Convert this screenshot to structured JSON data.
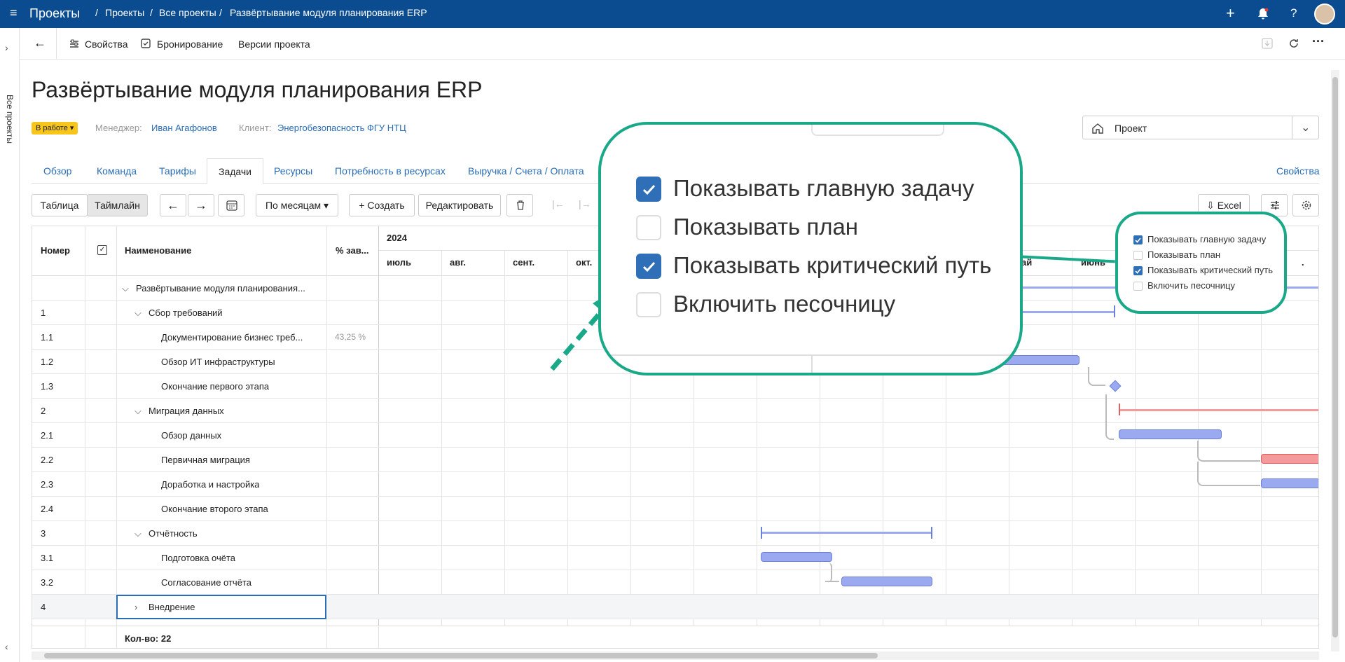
{
  "topbar": {
    "app_title": "Проекты",
    "breadcrumb": [
      "Проекты",
      "Все проекты",
      "Развёртывание модуля планирования ERP"
    ],
    "sep": "/"
  },
  "left_strip": {
    "label": "Все проекты"
  },
  "toolbar": {
    "properties": "Свойства",
    "booking": "Бронирование",
    "versions": "Версии проекта"
  },
  "project": {
    "title": "Развёртывание модуля планирования ERP",
    "status": "В работе",
    "manager_label": "Менеджер:",
    "manager": "Иван Агафонов",
    "client_label": "Клиент:",
    "client": "Энергобезопасность ФГУ НТЦ",
    "view_select": "Проект"
  },
  "tabs": [
    "Обзор",
    "Команда",
    "Тарифы",
    "Задачи",
    "Ресурсы",
    "Потребность в ресурсах",
    "Выручка / Счета / Оплата"
  ],
  "tabs_right": "Свойства",
  "task_toolbar": {
    "table": "Таблица",
    "timeline": "Таймлайн",
    "period": "По месяцам",
    "create": "+ Создать",
    "edit": "Редактировать",
    "excel": "Excel"
  },
  "grid": {
    "headers": {
      "number": "Номер",
      "name": "Наименование",
      "percent": "% зав..."
    },
    "year": "2024",
    "months": [
      "июль",
      "авг.",
      "сент.",
      "окт.",
      "ай",
      "июнь",
      "."
    ],
    "rows": [
      {
        "num": "",
        "name": "Развёртывание модуля планирования...",
        "pct": ""
      },
      {
        "num": "1",
        "name": "Сбор требований",
        "pct": ""
      },
      {
        "num": "1.1",
        "name": "Документирование бизнес треб...",
        "pct": "43,25 %"
      },
      {
        "num": "1.2",
        "name": "Обзор ИТ инфраструктуры",
        "pct": ""
      },
      {
        "num": "1.3",
        "name": "Окончание первого этапа",
        "pct": ""
      },
      {
        "num": "2",
        "name": "Миграция данных",
        "pct": ""
      },
      {
        "num": "2.1",
        "name": "Обзор данных",
        "pct": ""
      },
      {
        "num": "2.2",
        "name": "Первичная миграция",
        "pct": ""
      },
      {
        "num": "2.3",
        "name": "Доработка и настройка",
        "pct": ""
      },
      {
        "num": "2.4",
        "name": "Окончание второго этапа",
        "pct": ""
      },
      {
        "num": "3",
        "name": "Отчётность",
        "pct": ""
      },
      {
        "num": "3.1",
        "name": "Подготовка очёта",
        "pct": ""
      },
      {
        "num": "3.2",
        "name": "Согласование отчёта",
        "pct": ""
      },
      {
        "num": "4",
        "name": "Внедрение",
        "pct": ""
      }
    ],
    "footer": "Кол-во: 22"
  },
  "settings_popup": {
    "options": [
      {
        "label": "Показывать главную задачу",
        "checked": true
      },
      {
        "label": "Показывать план",
        "checked": false
      },
      {
        "label": "Показывать критический путь",
        "checked": true
      },
      {
        "label": "Включить песочницу",
        "checked": false
      }
    ]
  },
  "colors": {
    "topbar": "#0a4c8f",
    "accent": "#2a6db5",
    "callout": "#1aa988",
    "bar": "#9aa9f0",
    "critical": "#f59a9a",
    "badge": "#f7c51c"
  }
}
